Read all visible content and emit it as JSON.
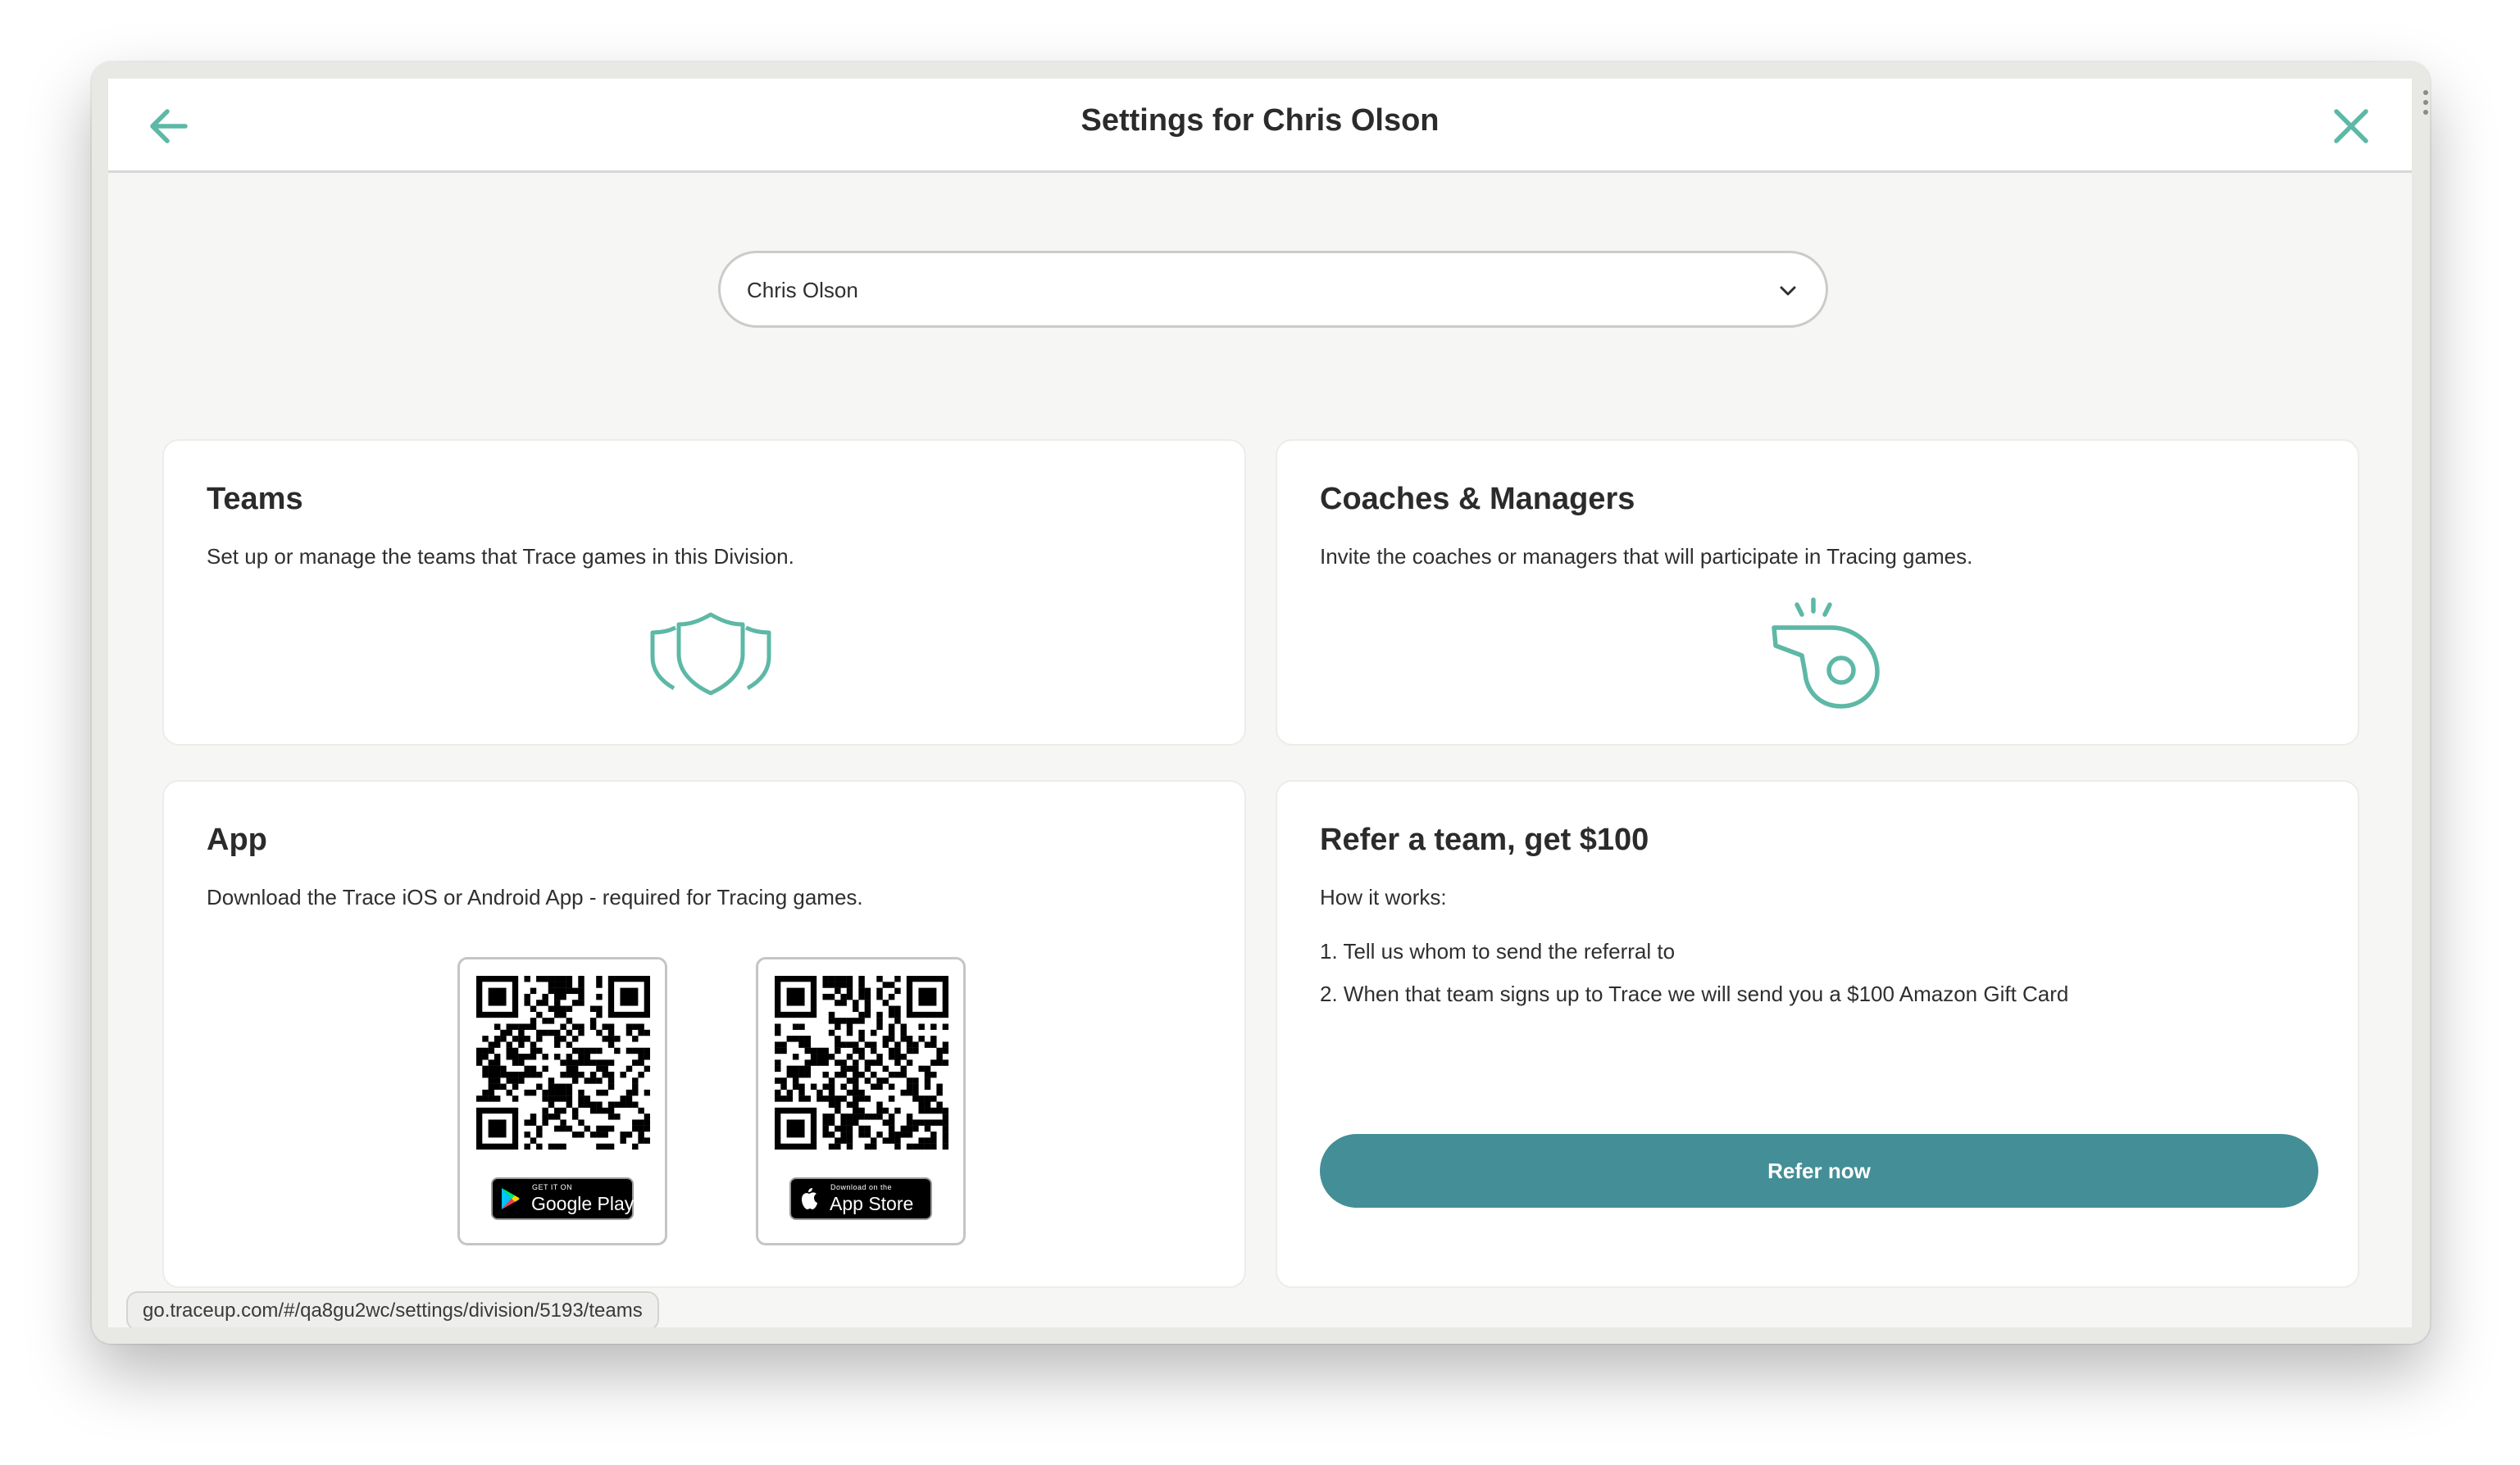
{
  "header": {
    "title": "Settings for Chris Olson"
  },
  "selector": {
    "value": "Chris Olson"
  },
  "teams_card": {
    "title": "Teams",
    "description": "Set up or manage the teams that Trace games in this Division."
  },
  "coaches_card": {
    "title": "Coaches & Managers",
    "description": "Invite the coaches or managers that will participate in Tracing games."
  },
  "app_card": {
    "title": "App",
    "description": "Download the Trace iOS or Android App - required for Tracing games.",
    "google_badge": {
      "small": "GET IT ON",
      "big": "Google Play"
    },
    "apple_badge": {
      "small": "Download on the",
      "big": "App Store"
    }
  },
  "refer_card": {
    "title": "Refer a team, get $100",
    "how_it_works": "How it works:",
    "steps": [
      "1. Tell us whom to send the referral to",
      "2. When that team signs up to Trace we will send you a $100 Amazon Gift Card"
    ],
    "button": "Refer now"
  },
  "status_bar": {
    "url": "go.traceup.com/#/qa8gu2wc/settings/division/5193/teams"
  },
  "colors": {
    "accent": "#5db8a6",
    "button": "#438e97",
    "card_bg": "#ffffff",
    "dialog_bg": "#f6f7f5"
  },
  "icons": {
    "back": "arrow-left-icon",
    "close": "close-icon",
    "select": "chevron-down-icon",
    "teams": "shields-icon",
    "coaches": "whistle-icon",
    "google": "google-play-logo-icon",
    "apple": "apple-logo-icon"
  }
}
